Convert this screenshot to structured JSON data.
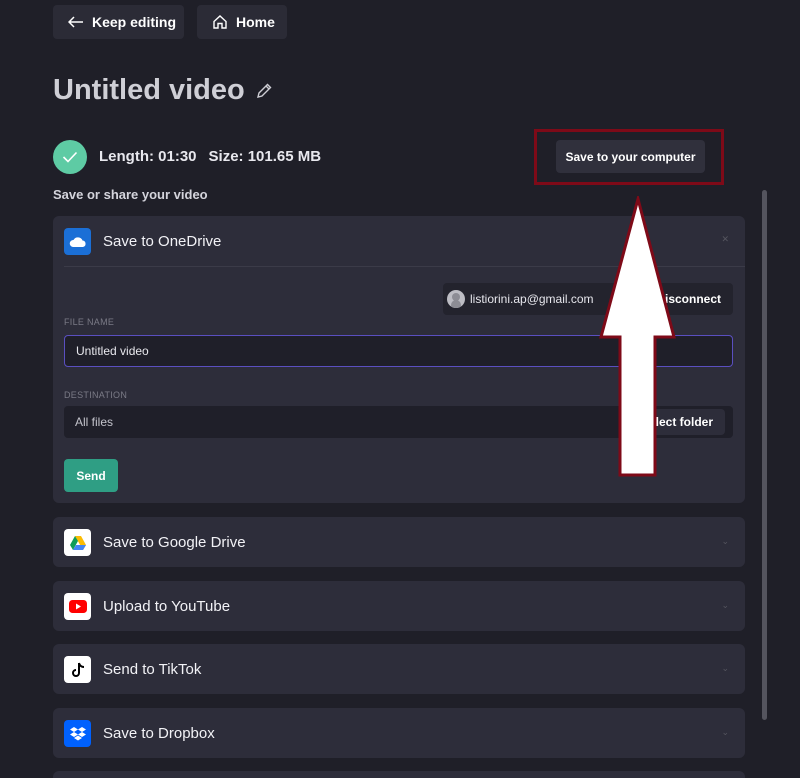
{
  "nav": {
    "keep_editing": "Keep editing",
    "home": "Home"
  },
  "video": {
    "title": "Untitled video",
    "length": "Length: 01:30",
    "size": "Size: 101.65 MB"
  },
  "save_share_heading": "Save or share your video",
  "save_computer_label": "Save to your computer",
  "onedrive": {
    "label": "Save to OneDrive",
    "account_email": "listiorini.ap@gmail.com",
    "disconnect_label": "Disconnect",
    "file_name_label": "FILE NAME",
    "file_name_value": "Untitled video",
    "destination_label": "DESTINATION",
    "destination_value": "All files",
    "select_folder_label": "Select folder",
    "send_label": "Send"
  },
  "services": [
    {
      "label": "Save to Google Drive",
      "icon": "google-drive-icon"
    },
    {
      "label": "Upload to YouTube",
      "icon": "youtube-icon"
    },
    {
      "label": "Send to TikTok",
      "icon": "tiktok-icon"
    },
    {
      "label": "Save to Dropbox",
      "icon": "dropbox-icon"
    }
  ],
  "colors": {
    "background": "#1f1f28",
    "panel": "#2d2d3a",
    "accent_green": "#5ecba4",
    "send_button": "#2f9e84",
    "highlight": "#7e0a18"
  }
}
